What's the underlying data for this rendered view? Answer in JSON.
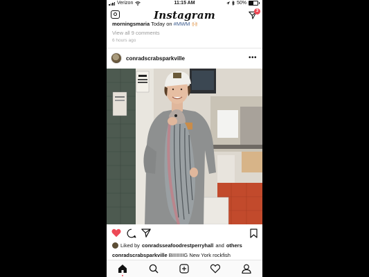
{
  "status_bar": {
    "carrier": "Verizon",
    "time": "11:15 AM",
    "battery": "50%"
  },
  "nav": {
    "app_title": "Instagram",
    "direct_badge": "3"
  },
  "previous_post": {
    "caption_user": "morningsmaria",
    "caption_text": " Today on ",
    "caption_tag": "#MWM 🙌🏻",
    "view_comments": "View all 9 comments",
    "time_ago": "6 hours ago"
  },
  "post": {
    "username": "conradscrabsparkville",
    "liked_by_prefix": "Liked by ",
    "liked_by_user": "conradsseafoodrestperryhall",
    "liked_by_joiner": " and ",
    "liked_by_others": "others",
    "caption_user": "conradscrabsparkville",
    "caption_text": " BIIIIIIIIG New York rockfish"
  },
  "colors": {
    "like_red": "#ed4956",
    "badge_red": "#ed4956",
    "link_blue": "#3a5a8c"
  }
}
